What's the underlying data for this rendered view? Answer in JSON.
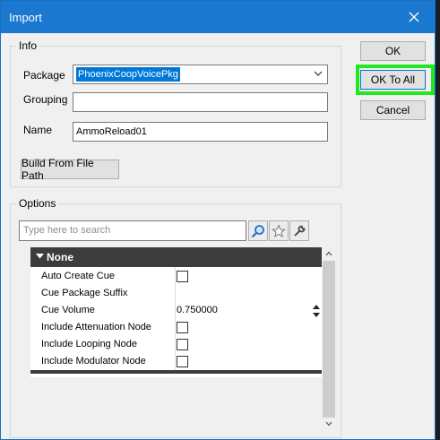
{
  "window": {
    "title": "Import"
  },
  "info_group": {
    "label": "Info",
    "package": {
      "label": "Package",
      "value": "PhoenixCoopVoicePkg"
    },
    "grouping": {
      "label": "Grouping",
      "value": ""
    },
    "name": {
      "label": "Name",
      "value": "AmmoReload01"
    },
    "build_button": "Build From File Path"
  },
  "options_group": {
    "label": "Options",
    "search_placeholder": "Type here to search",
    "category": "None",
    "properties": [
      {
        "name": "Auto Create Cue",
        "type": "checkbox",
        "checked": false
      },
      {
        "name": "Cue Package Suffix",
        "type": "text",
        "value": ""
      },
      {
        "name": "Cue Volume",
        "type": "number",
        "value": "0.750000"
      },
      {
        "name": "Include Attenuation Node",
        "type": "checkbox",
        "checked": false
      },
      {
        "name": "Include Looping Node",
        "type": "checkbox",
        "checked": false
      },
      {
        "name": "Include Modulator Node",
        "type": "checkbox",
        "checked": false
      }
    ]
  },
  "buttons": {
    "ok": "OK",
    "ok_to_all": "OK To All",
    "cancel": "Cancel"
  },
  "colors": {
    "titlebar": "#1a78d0",
    "highlight": "#22e822",
    "selection": "#0078d7",
    "category_header": "#3c3c3c"
  },
  "icons": [
    "close-icon",
    "chevron-down-icon",
    "search-icon",
    "star-icon",
    "settings-wrench-icon",
    "collapse-triangle-icon"
  ]
}
